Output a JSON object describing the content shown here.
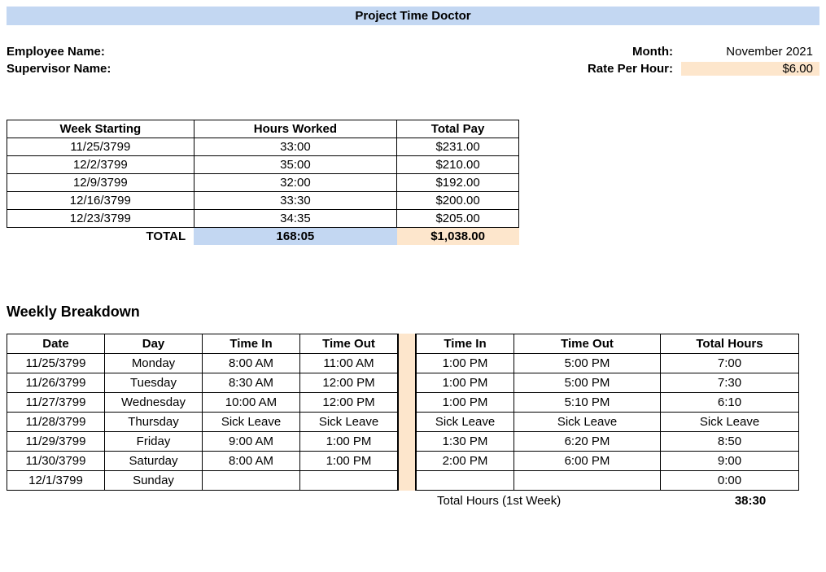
{
  "title": "Project Time Doctor",
  "header": {
    "employee_label": "Employee Name:",
    "supervisor_label": "Supervisor Name:",
    "month_label": "Month:",
    "month_value": "November 2021",
    "rate_label": "Rate Per Hour:",
    "rate_value": "$6.00"
  },
  "summary": {
    "cols": {
      "week": "Week Starting",
      "hours": "Hours Worked",
      "pay": "Total Pay"
    },
    "rows": [
      {
        "week": "11/25/3799",
        "hours": "33:00",
        "pay": "$231.00"
      },
      {
        "week": "12/2/3799",
        "hours": "35:00",
        "pay": "$210.00"
      },
      {
        "week": "12/9/3799",
        "hours": "32:00",
        "pay": "$192.00"
      },
      {
        "week": "12/16/3799",
        "hours": "33:30",
        "pay": "$200.00"
      },
      {
        "week": "12/23/3799",
        "hours": "34:35",
        "pay": "$205.00"
      }
    ],
    "total_label": "TOTAL",
    "total_hours": "168:05",
    "total_pay": "$1,038.00"
  },
  "breakdown_title": "Weekly Breakdown",
  "breakdown": {
    "cols": {
      "date": "Date",
      "day": "Day",
      "in1": "Time In",
      "out1": "Time Out",
      "in2": "Time In",
      "out2": "Time Out",
      "total": "Total Hours"
    },
    "rows": [
      {
        "date": "11/25/3799",
        "day": "Monday",
        "in1": "8:00 AM",
        "out1": "11:00 AM",
        "in2": "1:00 PM",
        "out2": "5:00 PM",
        "total": "7:00"
      },
      {
        "date": "11/26/3799",
        "day": "Tuesday",
        "in1": "8:30 AM",
        "out1": "12:00 PM",
        "in2": "1:00 PM",
        "out2": "5:00 PM",
        "total": "7:30"
      },
      {
        "date": "11/27/3799",
        "day": "Wednesday",
        "in1": "10:00 AM",
        "out1": "12:00 PM",
        "in2": "1:00 PM",
        "out2": "5:10 PM",
        "total": "6:10"
      },
      {
        "date": "11/28/3799",
        "day": "Thursday",
        "in1": "Sick Leave",
        "out1": "Sick Leave",
        "in2": "Sick Leave",
        "out2": "Sick Leave",
        "total": "Sick Leave"
      },
      {
        "date": "11/29/3799",
        "day": "Friday",
        "in1": "9:00 AM",
        "out1": "1:00 PM",
        "in2": "1:30 PM",
        "out2": "6:20 PM",
        "total": "8:50"
      },
      {
        "date": "11/30/3799",
        "day": "Saturday",
        "in1": "8:00 AM",
        "out1": "1:00 PM",
        "in2": "2:00 PM",
        "out2": "6:00 PM",
        "total": "9:00"
      },
      {
        "date": "12/1/3799",
        "day": "Sunday",
        "in1": "",
        "out1": "",
        "in2": "",
        "out2": "",
        "total": "0:00"
      }
    ],
    "footer_label": "Total Hours (1st Week)",
    "footer_value": "38:30"
  }
}
